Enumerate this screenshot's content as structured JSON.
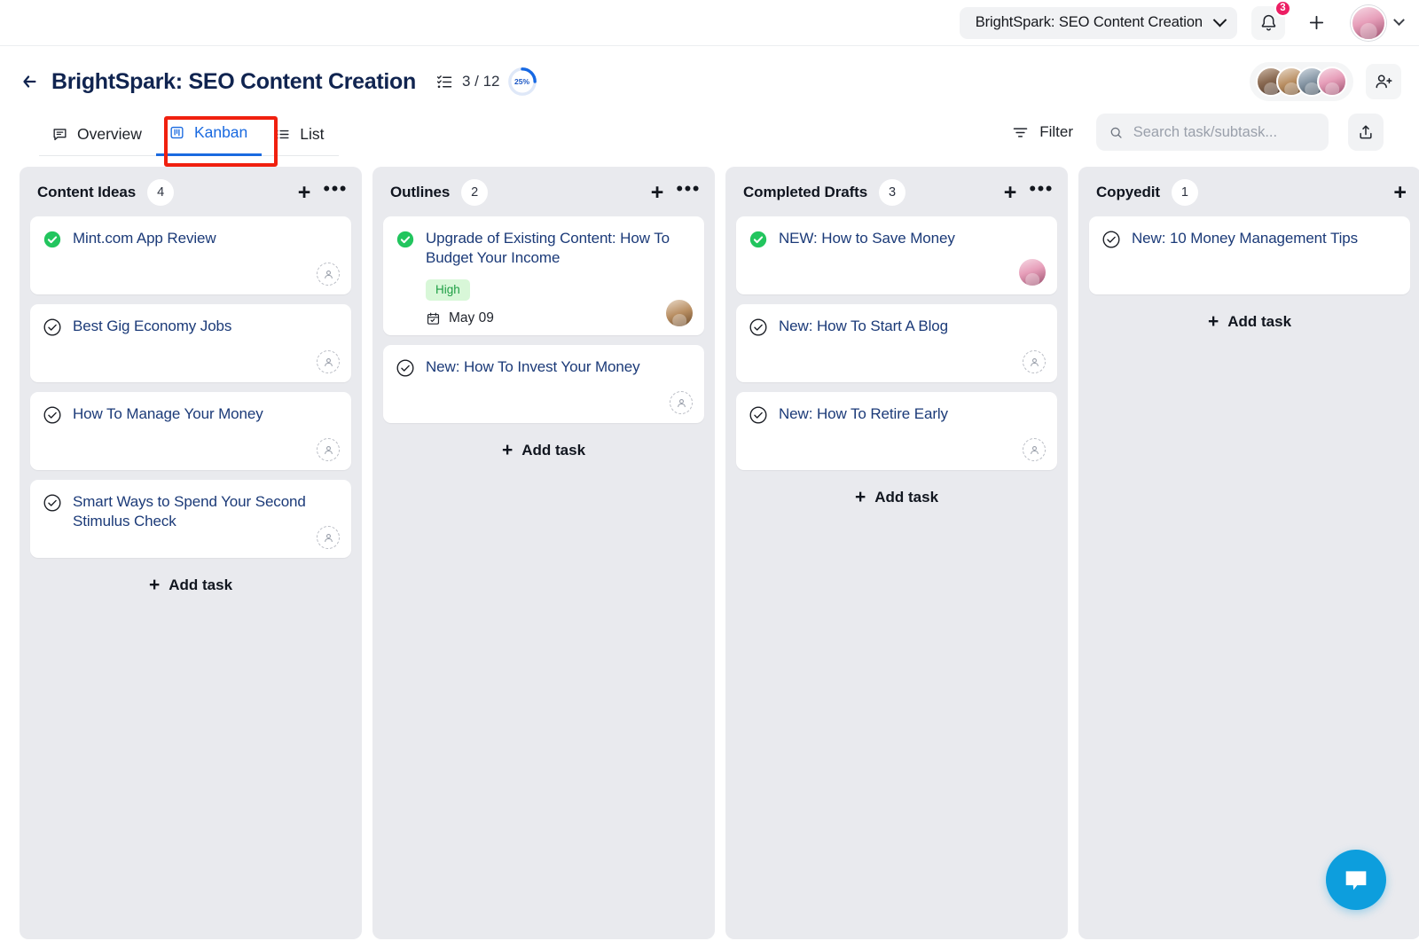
{
  "appbar": {
    "workspace_label": "BrightSpark: SEO Content Creation",
    "workspace_chevron_icon": "chevron-down-icon",
    "notifications_icon": "bell-icon",
    "notifications_count": "3",
    "add_icon": "plus-icon",
    "profile_avatar_icon": "user-avatar",
    "profile_chevron_icon": "chevron-down-icon"
  },
  "project": {
    "back_icon": "arrow-left-icon",
    "title": "BrightSpark: SEO Content Creation",
    "subtask_icon": "checklist-icon",
    "subtask_progress": "3 / 12",
    "progress_percent": "25%",
    "members_icon": "member-avatars",
    "share_icon": "add-person-icon"
  },
  "tabs": [
    {
      "label": "Overview",
      "icon": "comment-icon",
      "active": false
    },
    {
      "label": "Kanban",
      "icon": "kanban-board-icon",
      "active": true
    },
    {
      "label": "List",
      "icon": "list-icon",
      "active": false
    }
  ],
  "toolbar": {
    "filter_label": "Filter",
    "filter_icon": "filter-icon",
    "search_icon": "search-icon",
    "search_placeholder": "Search task/subtask...",
    "search_value": "",
    "export_icon": "export-upload-icon"
  },
  "board": {
    "add_task_label": "Add task",
    "add_column_icon": "plus-icon",
    "column_menu_icon": "more-horizontal-icon",
    "columns": [
      {
        "name": "Content Ideas",
        "count": "4",
        "show_add_task": true,
        "show_menu": true,
        "cards": [
          {
            "title": "Mint.com App Review",
            "done": true,
            "assignee": "unassigned",
            "priority": "",
            "due": ""
          },
          {
            "title": "Best Gig Economy Jobs",
            "done": false,
            "assignee": "unassigned",
            "priority": "",
            "due": ""
          },
          {
            "title": "How To Manage Your Money",
            "done": false,
            "assignee": "unassigned",
            "priority": "",
            "due": ""
          },
          {
            "title": "Smart Ways to Spend Your Second Stimulus Check",
            "done": false,
            "assignee": "unassigned",
            "priority": "",
            "due": ""
          }
        ]
      },
      {
        "name": "Outlines",
        "count": "2",
        "show_add_task": true,
        "show_menu": true,
        "cards": [
          {
            "title": "Upgrade of Existing Content: How To Budget Your Income",
            "done": true,
            "assignee": "avatar",
            "priority": "High",
            "due": "May 09"
          },
          {
            "title": "New: How To Invest Your Money",
            "done": false,
            "assignee": "unassigned",
            "priority": "",
            "due": ""
          }
        ]
      },
      {
        "name": "Completed Drafts",
        "count": "3",
        "show_add_task": true,
        "show_menu": true,
        "cards": [
          {
            "title": "NEW: How to Save Money",
            "done": true,
            "assignee": "avatar",
            "priority": "",
            "due": ""
          },
          {
            "title": "New: How To Start A Blog",
            "done": false,
            "assignee": "unassigned",
            "priority": "",
            "due": ""
          },
          {
            "title": "New: How To Retire Early",
            "done": false,
            "assignee": "unassigned",
            "priority": "",
            "due": ""
          }
        ]
      },
      {
        "name": "Copyedit",
        "count": "1",
        "show_add_task": true,
        "show_menu": false,
        "cards": [
          {
            "title": "New: 10 Money Management Tips",
            "done": false,
            "assignee": "none",
            "priority": "",
            "due": ""
          }
        ]
      }
    ]
  },
  "chat": {
    "icon": "chat-bubble-icon"
  },
  "colors": {
    "accent_blue": "#1a6ae0",
    "title_navy": "#102450",
    "card_title": "#1b3a78",
    "done_green": "#22c55e",
    "priority_green_bg": "#d8f7d8",
    "priority_green_text": "#1f9f45",
    "badge_pink": "#ec1e63",
    "column_bg": "#e9eaee",
    "chat_blue": "#0d9edd",
    "highlight_red": "#f0200f"
  }
}
